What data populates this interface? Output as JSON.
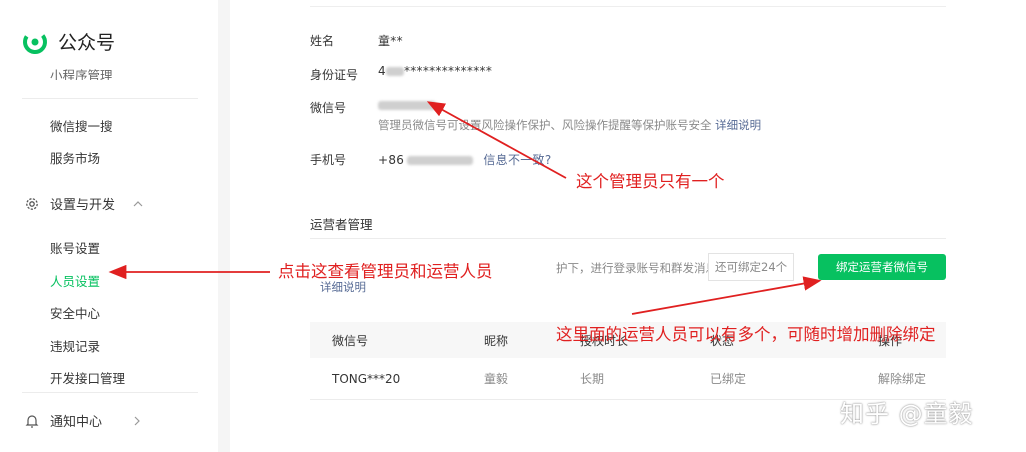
{
  "app": {
    "title": "公众号"
  },
  "sidebar": {
    "items": [
      {
        "label": "小程序管理"
      },
      {
        "label": "微信搜一搜"
      },
      {
        "label": "服务市场"
      }
    ],
    "group_settings": {
      "label": "设置与开发"
    },
    "settings_items": [
      {
        "label": "账号设置"
      },
      {
        "label": "人员设置",
        "active": true
      },
      {
        "label": "安全中心"
      },
      {
        "label": "违规记录"
      },
      {
        "label": "开发接口管理"
      }
    ],
    "group_notify": {
      "label": "通知中心"
    }
  },
  "profile": {
    "name_label": "姓名",
    "name_value": "童**",
    "id_label": "身份证号",
    "id_prefix": "4",
    "id_masked": "**************",
    "wechat_label": "微信号",
    "wechat_hint": "管理员微信号可设置风险操作保护、风险操作提醒等保护账号安全",
    "wechat_hint_link": "详细说明",
    "phone_label": "手机号",
    "phone_prefix": "+86",
    "phone_link": "信息不一致?"
  },
  "operators": {
    "section_title": "运营者管理",
    "desc": "护下，进行登录账号和群发消息操作",
    "remaining": "还可绑定24个",
    "bind_button": "绑定运营者微信号",
    "detail_link": "详细说明",
    "table": {
      "headers": [
        "微信号",
        "昵称",
        "授权时长",
        "状态",
        "操作"
      ],
      "rows": [
        {
          "wechat": "TONG***20",
          "nickname": "童毅",
          "duration": "长期",
          "status": "已绑定",
          "action": "解除绑定"
        }
      ]
    }
  },
  "annotations": {
    "admin_note": "这个管理员只有一个",
    "click_note": "点击这查看管理员和运营人员",
    "operators_note": "这里面的运营人员可以有多个，可随时增加删除绑定",
    "color": "#e02020"
  },
  "watermark": {
    "text": "知乎 @童毅"
  },
  "colors": {
    "brand": "#07c160",
    "link": "#576b95"
  }
}
